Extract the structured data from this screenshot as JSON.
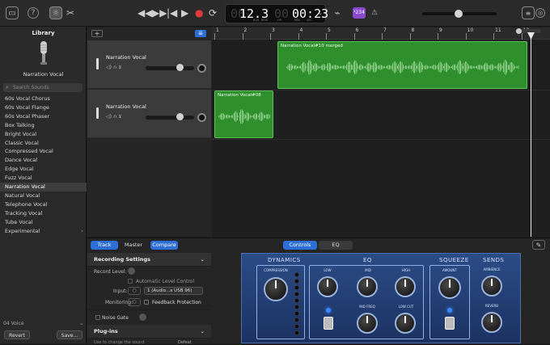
{
  "toolbar": {
    "lcd": {
      "bar": "12.3",
      "beat_label": "BAR",
      "beat2_label": "BEAT",
      "time": "00:23",
      "time_label1": "HR",
      "time_label2": "MIN",
      "time_label3": "SEC"
    },
    "count_in_badge": "¹234",
    "icons": [
      "library-icon",
      "quick-help-icon",
      "smart-controls-icon",
      "scissors-icon",
      "rewind-icon",
      "fast-forward-icon",
      "go-to-start-icon",
      "play-icon",
      "record-icon",
      "cycle-icon",
      "tuner-icon",
      "metronome-icon",
      "notepad-icon",
      "loop-browser-icon"
    ]
  },
  "library": {
    "title": "Library",
    "patch_name": "Narration Vocal",
    "search_placeholder": "Search Sounds",
    "items": [
      "60s Vocal Chorus",
      "60s Vocal Flange",
      "60s Vocal Phaser",
      "Box Talking",
      "Bright Vocal",
      "Classic Vocal",
      "Compressed Vocal",
      "Dance Vocal",
      "Edge Vocal",
      "Fuzz Vocal",
      "Narration Vocal",
      "Natural Vocal",
      "Telephone Vocal",
      "Tracking Vocal",
      "Tube Vocal",
      "Experimental"
    ],
    "selected_index": 10,
    "footer_version": "04 Voice",
    "revert_label": "Revert",
    "save_label": "Save..."
  },
  "tracks": [
    {
      "name": "Narration Vocal",
      "volume": 0.62
    },
    {
      "name": "Narration Vocal",
      "volume": 0.62
    }
  ],
  "ruler": [
    "1",
    "2",
    "3",
    "4",
    "5",
    "6",
    "7",
    "8",
    "9",
    "10",
    "11",
    "12"
  ],
  "regions": [
    {
      "name": "Narration Vocal#10 merged"
    },
    {
      "name": "Narration Vocal#08"
    }
  ],
  "bottom": {
    "tabs": [
      "Track",
      "Master",
      "Compare"
    ],
    "plugin_tabs": [
      "Controls",
      "EQ"
    ],
    "recording_settings": "Recording Settings",
    "record_level_label": "Record Level:",
    "auto_level_label": "Automatic Level Control",
    "input_label": "Input:",
    "input_value": "1 (Audio...x USB 96)",
    "monitoring_label": "Monitoring:",
    "feedback_label": "Feedback Protection",
    "noise_gate_label": "Noise Gate",
    "plugins_label": "Plug-ins",
    "plugins_hint": "Use to change the sound",
    "defeat_label": "Defeat"
  },
  "plugin": {
    "sections": [
      "DYNAMICS",
      "EQ",
      "SQUEEZE",
      "SENDS"
    ],
    "knobs": [
      "COMPRESSION",
      "LOW",
      "MID",
      "HIGH",
      "LOW CUT",
      "MID FREQ",
      "AMOUNT",
      "AMBIENCE",
      "REVERB"
    ]
  }
}
